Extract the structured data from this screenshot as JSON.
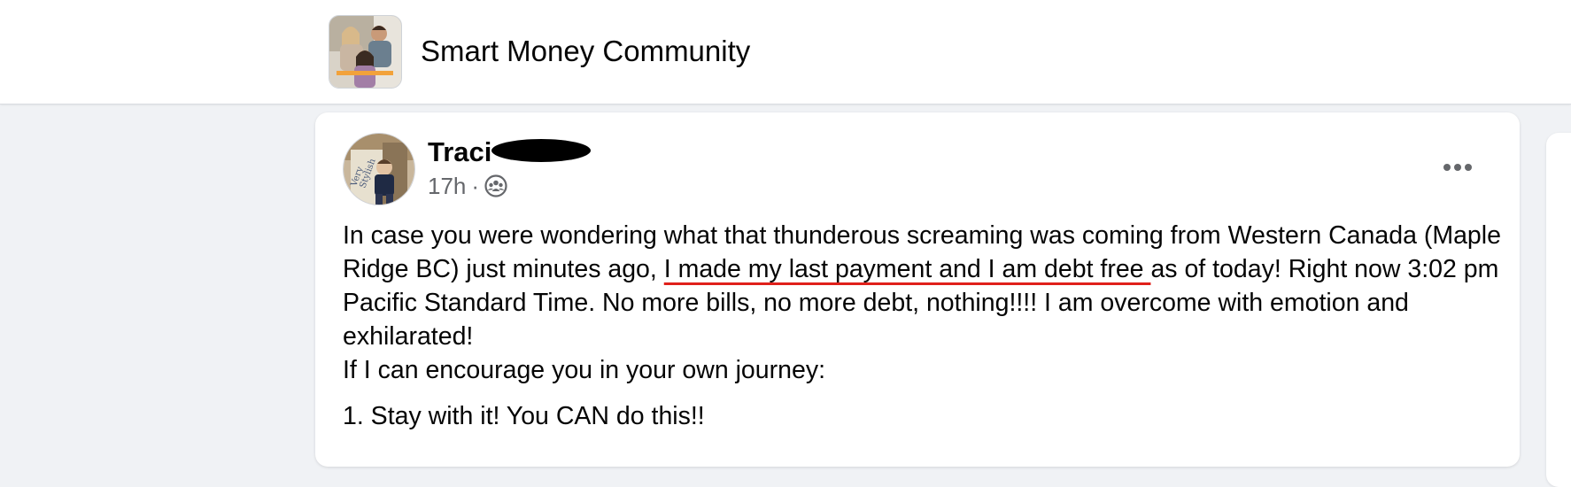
{
  "group": {
    "name": "Smart Money Community",
    "avatar_icon": "group-photo-avatar"
  },
  "post": {
    "author": "Traci",
    "time": "17h",
    "separator": "·",
    "privacy_icon": "group-members-icon",
    "more_icon": "more-options-icon",
    "body": {
      "line1_pre": "In case you were wondering what that thunderous screaming was coming from Western Canada (Maple Ridge BC) just minutes ago,  ",
      "highlight": "I made my last payment and I am debt free ",
      "line1_post": "as of today!  Right now 3:02 pm Pacific Standard Time.  No more bills, no more debt, nothing!!!! I am overcome with emotion  and exhilarated!",
      "line2": "If I can encourage you in your own journey:",
      "item1": "1. Stay with it! You CAN do this!!"
    },
    "highlight_color": "#e0201b"
  }
}
